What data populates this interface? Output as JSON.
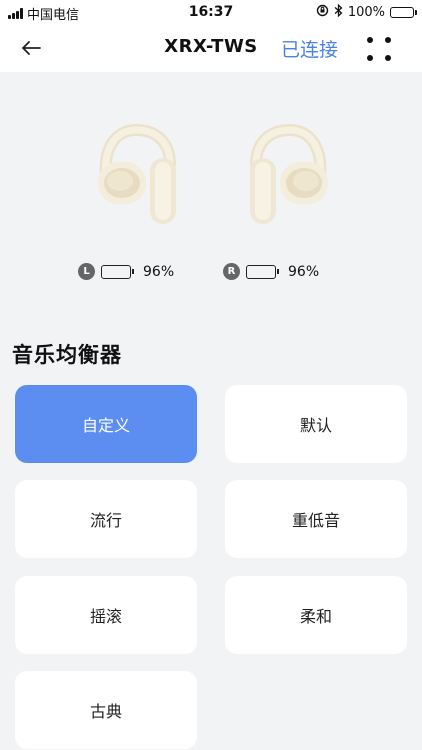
{
  "status_bar": {
    "carrier": "中国电信",
    "time": "16:37",
    "battery": "100%"
  },
  "nav": {
    "title": "XRX-TWS",
    "status": "已连接"
  },
  "earbuds": {
    "left": {
      "side": "L",
      "battery": "96%"
    },
    "right": {
      "side": "R",
      "battery": "96%"
    }
  },
  "equalizer": {
    "title": "音乐均衡器",
    "presets": [
      {
        "label": "自定义",
        "selected": true
      },
      {
        "label": "默认",
        "selected": false
      },
      {
        "label": "流行",
        "selected": false
      },
      {
        "label": "重低音",
        "selected": false
      },
      {
        "label": "摇滚",
        "selected": false
      },
      {
        "label": "柔和",
        "selected": false
      },
      {
        "label": "古典",
        "selected": false
      }
    ]
  },
  "colors": {
    "accent": "#4a82e8",
    "selected_preset": "#5b8ef0",
    "battery_fill": "#2ec92e",
    "background": "#f2f3f5"
  }
}
